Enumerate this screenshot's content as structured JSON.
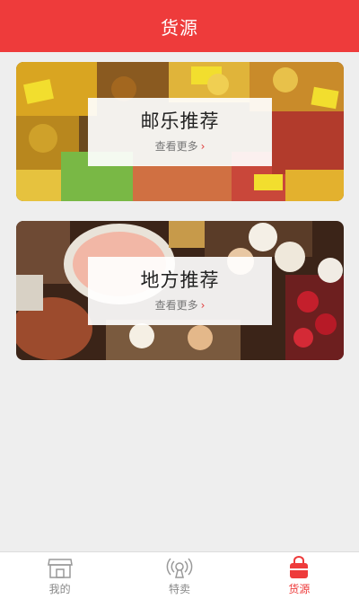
{
  "header": {
    "title": "货源"
  },
  "cards": [
    {
      "title": "邮乐推荐",
      "more": "查看更多",
      "chevron": "›"
    },
    {
      "title": "地方推荐",
      "more": "查看更多",
      "chevron": "›"
    }
  ],
  "tabbar": {
    "items": [
      {
        "label": "我的",
        "icon": "store-icon",
        "active": false
      },
      {
        "label": "特卖",
        "icon": "broadcast-icon",
        "active": false
      },
      {
        "label": "货源",
        "icon": "bag-icon",
        "active": true
      }
    ]
  },
  "colors": {
    "accent": "#ee3b3b",
    "background": "#eeeeee"
  }
}
